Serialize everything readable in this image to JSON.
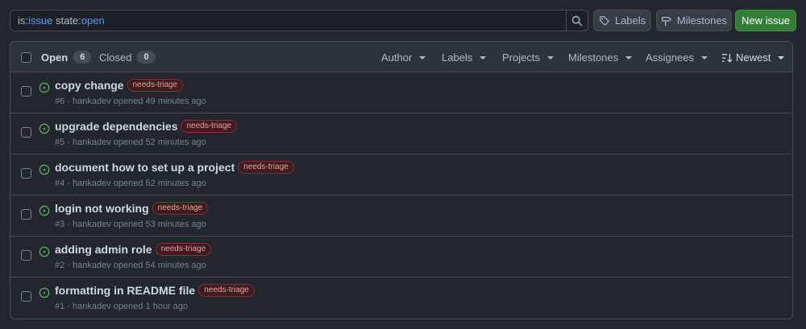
{
  "search": {
    "qualifier_issue_key": "is:",
    "qualifier_issue_value": "issue",
    "qualifier_state_key": " state:",
    "qualifier_state_value": "open"
  },
  "toolbar": {
    "labels_label": "Labels",
    "milestones_label": "Milestones",
    "new_issue_label": "New issue"
  },
  "header": {
    "open_label": "Open",
    "open_count": "6",
    "closed_label": "Closed",
    "closed_count": "0",
    "filters": {
      "author": "Author",
      "labels": "Labels",
      "projects": "Projects",
      "milestones": "Milestones",
      "assignees": "Assignees",
      "sort": "Newest"
    }
  },
  "issues": [
    {
      "title": "copy change",
      "label": "needs-triage",
      "meta": "#6 · hankadev opened 49 minutes ago"
    },
    {
      "title": "upgrade dependencies",
      "label": "needs-triage",
      "meta": "#5 · hankadev opened 52 minutes ago"
    },
    {
      "title": "document how to set up a project",
      "label": "needs-triage",
      "meta": "#4 · hankadev opened 52 minutes ago"
    },
    {
      "title": "login not working",
      "label": "needs-triage",
      "meta": "#3 · hankadev opened 53 minutes ago"
    },
    {
      "title": "adding admin role",
      "label": "needs-triage",
      "meta": "#2 · hankadev opened 54 minutes ago"
    },
    {
      "title": "formatting in README file",
      "label": "needs-triage",
      "meta": "#1 · hankadev opened 1 hour ago"
    }
  ],
  "colors": {
    "open_issue": "#57ab5a",
    "accent": "#539bf5",
    "primary_button": "#347d39"
  }
}
